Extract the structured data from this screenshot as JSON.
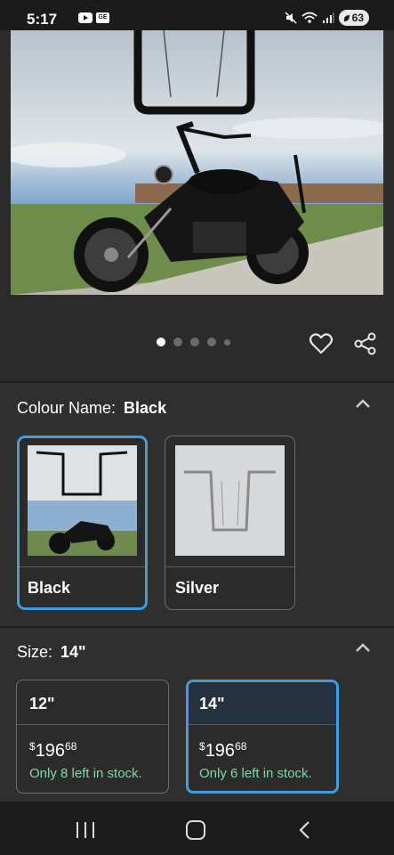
{
  "status_bar": {
    "time": "5:17",
    "battery": "63"
  },
  "gallery": {
    "dot_count": 5,
    "active_dot": 0
  },
  "colour": {
    "heading_label": "Colour Name:",
    "heading_value": "Black",
    "options": [
      {
        "label": "Black",
        "selected": true
      },
      {
        "label": "Silver",
        "selected": false
      }
    ]
  },
  "size": {
    "heading_label": "Size:",
    "heading_value": "14\"",
    "options": [
      {
        "label": "12\"",
        "currency": "$",
        "price_whole": "196",
        "price_cents": "68",
        "stock": "Only 8 left in stock.",
        "selected": false
      },
      {
        "label": "14\"",
        "currency": "$",
        "price_whole": "196",
        "price_cents": "68",
        "stock": "Only 6 left in stock.",
        "selected": true
      }
    ]
  },
  "colors": {
    "selected_border": "#3d9ee0",
    "stock_text": "#7fd9a4",
    "background": "#2b2b2b"
  }
}
